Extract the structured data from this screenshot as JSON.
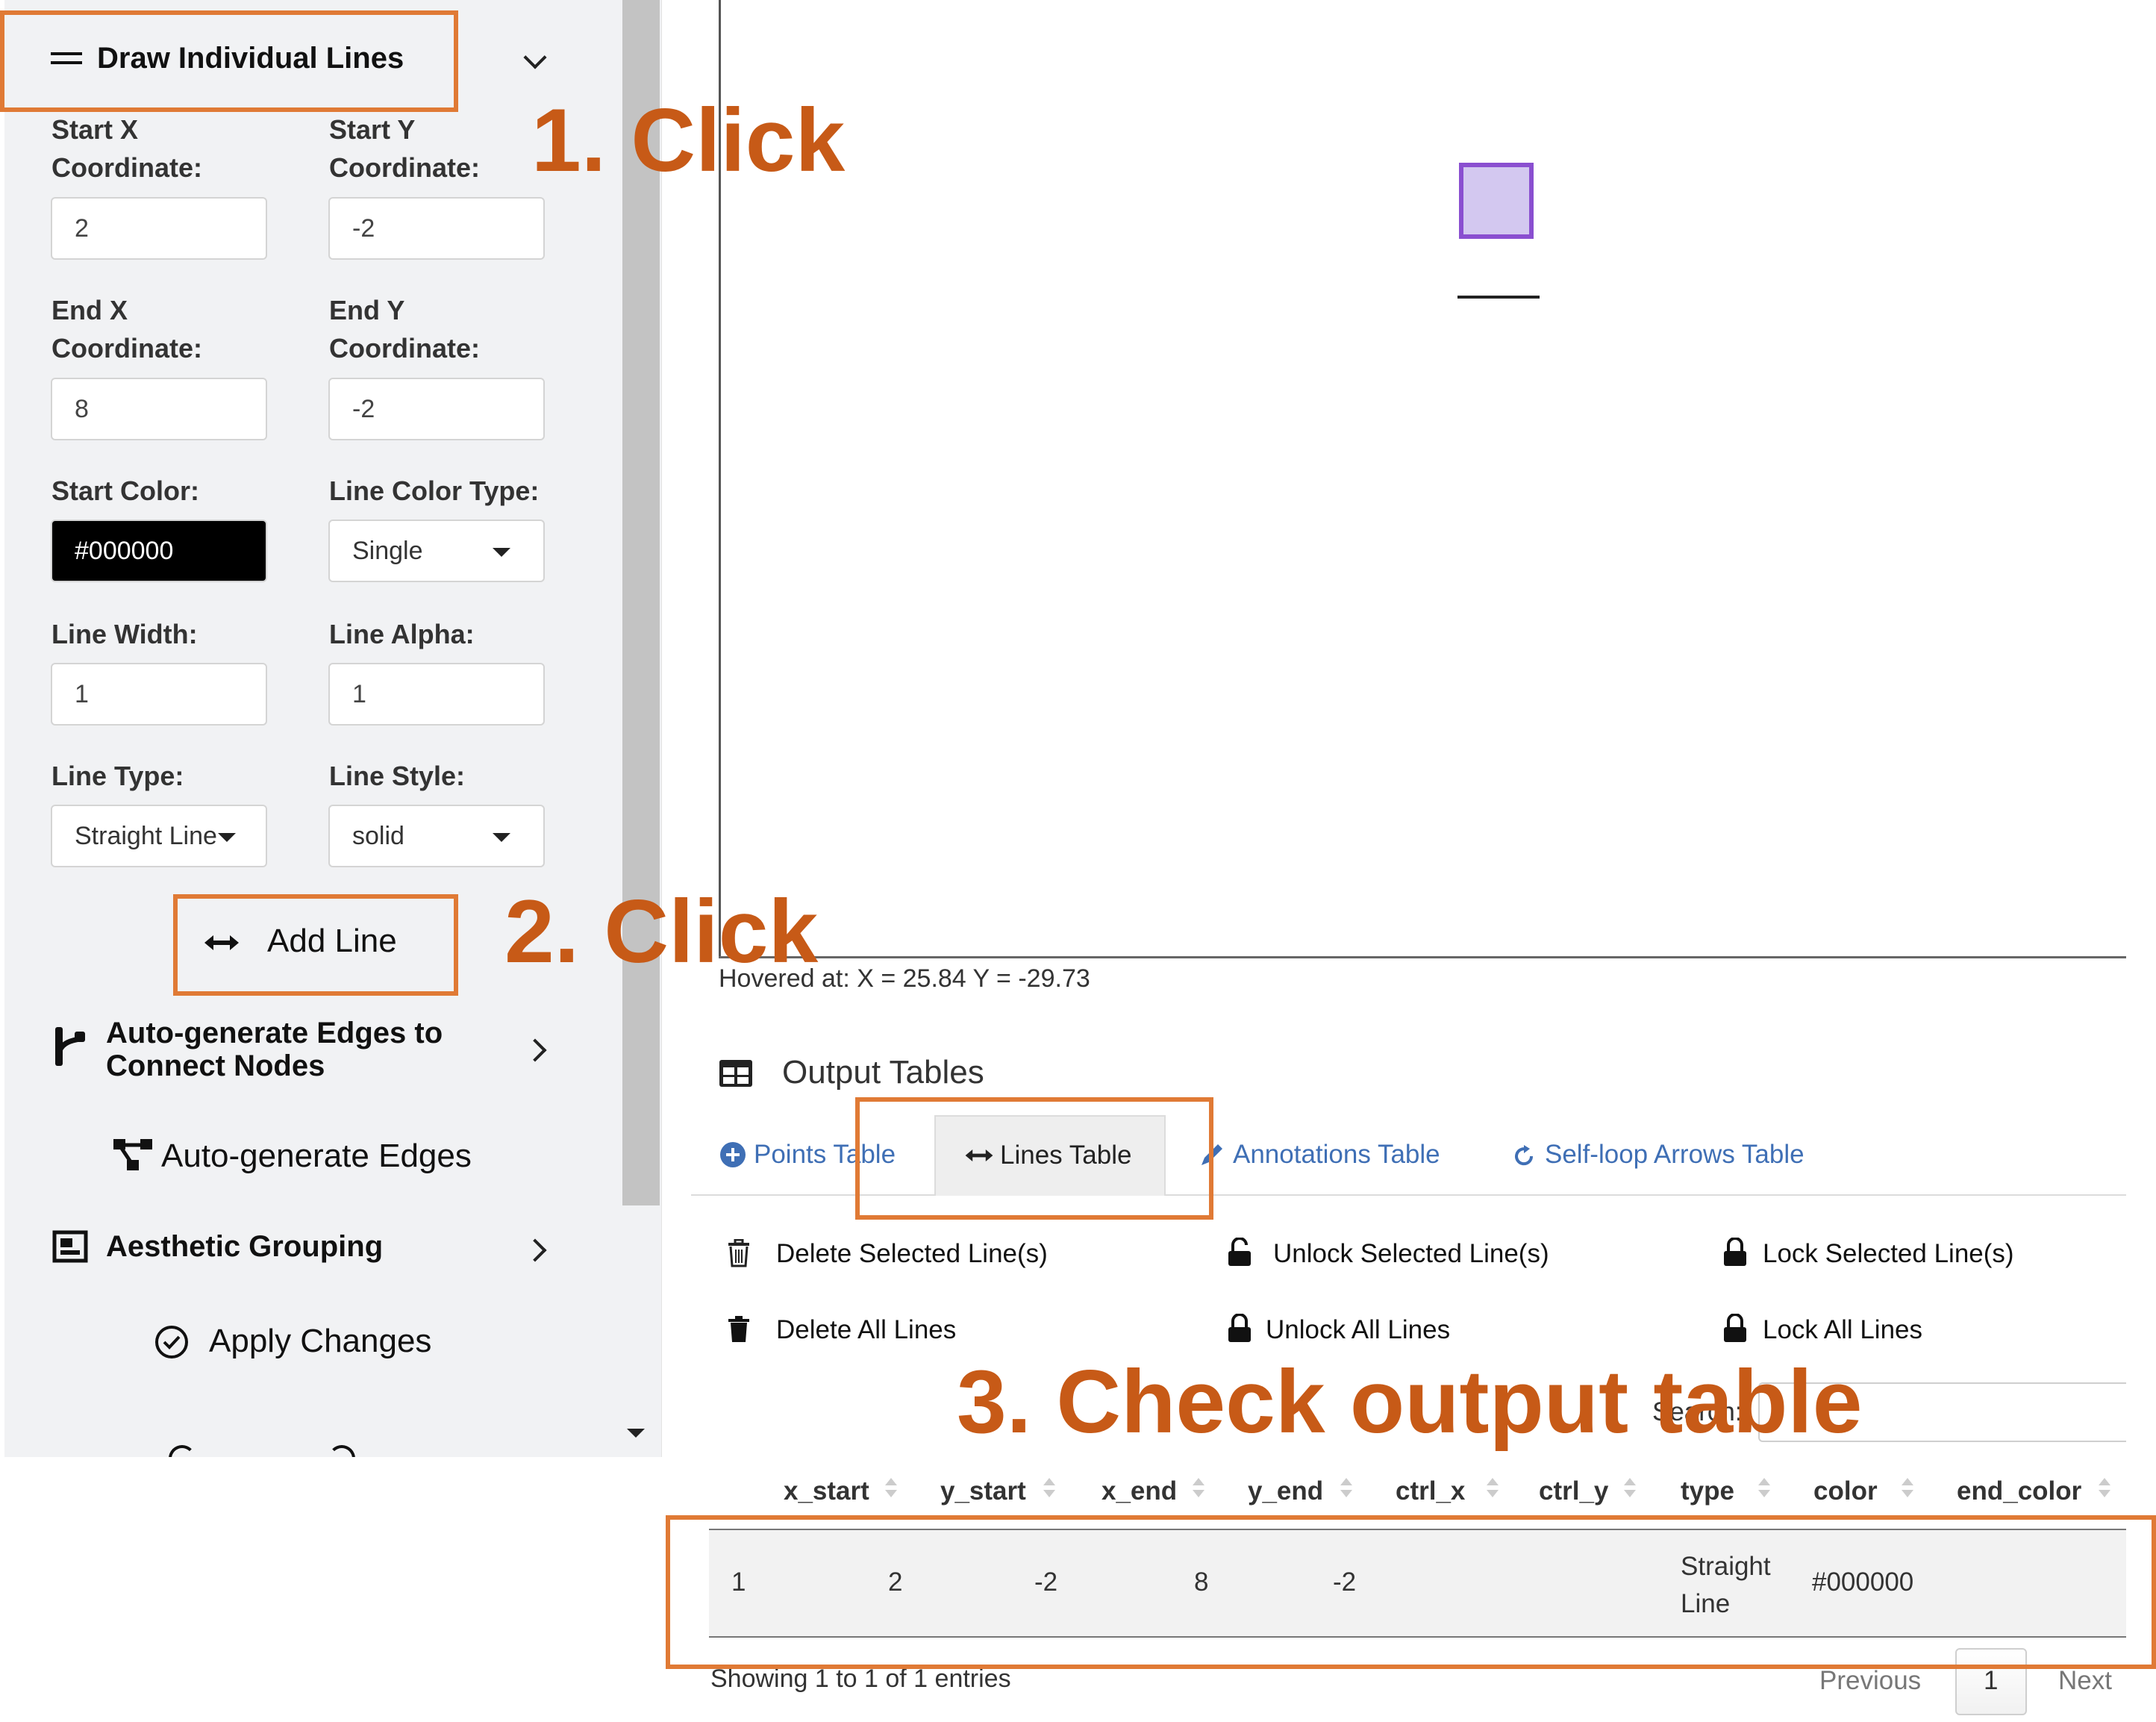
{
  "sidebar": {
    "section_title": "Draw Individual Lines",
    "fields": {
      "start_x_label_1": "Start X",
      "start_x_label_2": "Coordinate:",
      "start_x_value": "2",
      "start_y_label_1": "Start Y",
      "start_y_label_2": "Coordinate:",
      "start_y_value": "-2",
      "end_x_label_1": "End X",
      "end_x_label_2": "Coordinate:",
      "end_x_value": "8",
      "end_y_label_1": "End Y",
      "end_y_label_2": "Coordinate:",
      "end_y_value": "-2",
      "start_color_label": "Start Color:",
      "start_color_value": "#000000",
      "line_color_type_label": "Line Color Type:",
      "line_color_type_value": "Single",
      "line_width_label": "Line Width:",
      "line_width_value": "1",
      "line_alpha_label": "Line Alpha:",
      "line_alpha_value": "1",
      "line_type_label": "Line Type:",
      "line_type_value": "Straight Line",
      "line_style_label": "Line Style:",
      "line_style_value": "solid"
    },
    "add_line_label": "Add Line",
    "autogen_section_1": "Auto-generate Edges to",
    "autogen_section_2": "Connect Nodes",
    "autogen_button": "Auto-generate Edges",
    "aesthetic_section": "Aesthetic Grouping",
    "apply_button": "Apply Changes"
  },
  "plot": {
    "hover_text": "Hovered at: X = 25.84 Y = -29.73"
  },
  "output": {
    "title": "Output Tables",
    "tabs": [
      "Points Table",
      "Lines Table",
      "Annotations Table",
      "Self-loop Arrows Table"
    ],
    "actions": {
      "delete_selected": "Delete Selected Line(s)",
      "unlock_selected": "Unlock Selected Line(s)",
      "lock_selected": "Lock Selected Line(s)",
      "delete_all": "Delete All Lines",
      "unlock_all": "Unlock All Lines",
      "lock_all": "Lock All Lines"
    },
    "search_label": "Search:",
    "columns": [
      "x_start",
      "y_start",
      "x_end",
      "y_end",
      "ctrl_x",
      "ctrl_y",
      "type",
      "color",
      "end_color"
    ],
    "row": {
      "index": "1",
      "x_start": "2",
      "y_start": "-2",
      "x_end": "8",
      "y_end": "-2",
      "type_1": "Straight",
      "type_2": "Line",
      "color": "#000000"
    },
    "info": "Showing 1 to 1 of 1 entries",
    "pagination": {
      "previous": "Previous",
      "page": "1",
      "next": "Next"
    }
  },
  "annotations": {
    "step1": "1. Click",
    "step2": "2. Click",
    "step3": "3. Check output table"
  },
  "colors": {
    "highlight": "#e07a35",
    "annotation_text": "#c75a17",
    "node_fill": "#d3c8f0",
    "node_stroke": "#8a4fd0"
  }
}
